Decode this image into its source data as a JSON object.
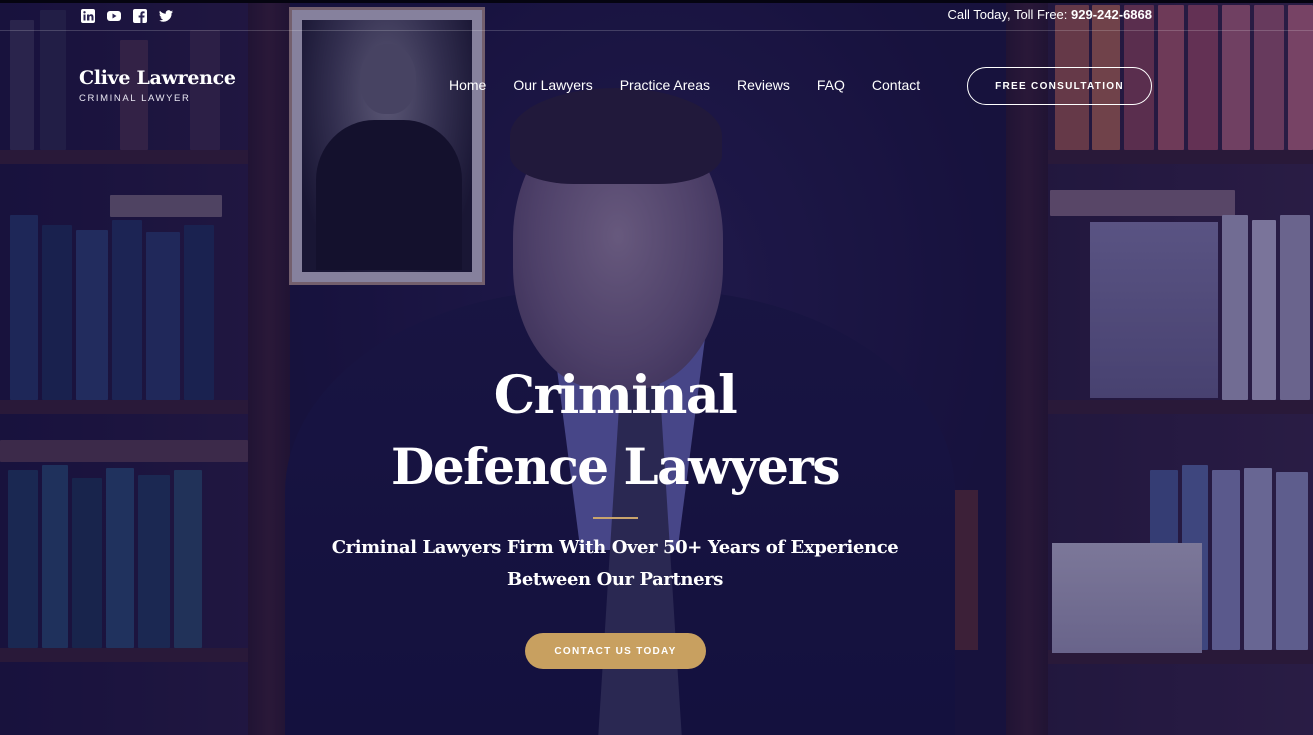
{
  "topbar": {
    "social": [
      {
        "icon": "linkedin-icon"
      },
      {
        "icon": "youtube-icon"
      },
      {
        "icon": "facebook-icon"
      },
      {
        "icon": "twitter-icon"
      }
    ],
    "call_label": "Call Today, Toll Free:",
    "phone": "929-242-6868"
  },
  "brand": {
    "name": "Clive Lawrence",
    "tagline": "CRIMINAL LAWYER"
  },
  "nav": {
    "items": [
      "Home",
      "Our Lawyers",
      "Practice Areas",
      "Reviews",
      "FAQ",
      "Contact"
    ],
    "cta_label": "FREE CONSULTATION"
  },
  "hero": {
    "title_line1": "Criminal",
    "title_line2": "Defence Lawyers",
    "subtitle_line1": "Criminal Lawyers Firm With Over 50+ Years of Experience",
    "subtitle_line2": "Between Our Partners",
    "cta_label": "CONTACT US TODAY"
  },
  "colors": {
    "accent_gold": "#c8a060",
    "overlay_navy": "#120e46"
  }
}
